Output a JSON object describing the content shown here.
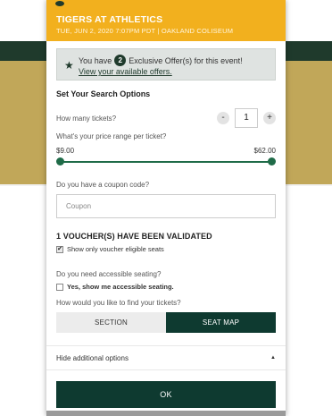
{
  "header": {
    "title": "TIGERS AT ATHLETICS",
    "subtitle": "TUE, JUN 2, 2020 7:07PM PDT | OAKLAND COLISEUM"
  },
  "offer": {
    "prefix": "You have",
    "count": "2",
    "suffix": "Exclusive Offer(s) for this event!",
    "link": "View your available offers."
  },
  "search": {
    "title": "Set Your Search Options",
    "tickets_label": "How many tickets?",
    "minus": "-",
    "quantity": "1",
    "plus": "+",
    "price_label": "What's your price range per ticket?",
    "price_min": "$9.00",
    "price_max": "$62.00",
    "coupon_label": "Do you have a coupon code?",
    "coupon_placeholder": "Coupon",
    "voucher_title": "1 VOUCHER(S) HAVE BEEN VALIDATED",
    "voucher_check": "Show only voucher eligible seats",
    "accessible_label": "Do you need accessible seating?",
    "accessible_check": "Yes, show me accessible seating.",
    "find_label": "How would you like to find your tickets?",
    "section_option": "SECTION",
    "seatmap_option": "SEAT MAP",
    "hide_options": "Hide additional options",
    "ok": "OK"
  },
  "colors": {
    "header": "#f2b01e",
    "dark_green": "#0e3a30",
    "slider_green": "#1f6b48"
  },
  "icons": {
    "star": "star-icon",
    "caret": "caret-up-icon"
  }
}
